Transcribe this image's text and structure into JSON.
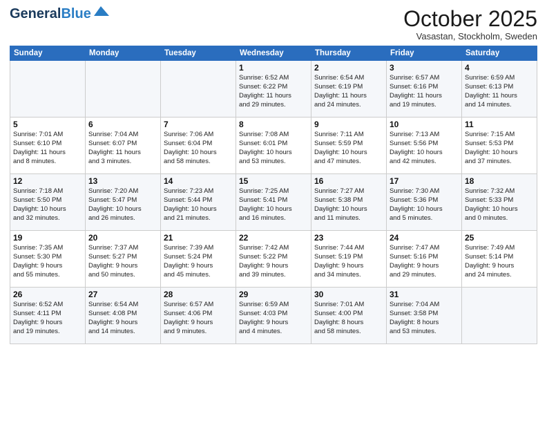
{
  "logo": {
    "line1": "General",
    "line2": "Blue"
  },
  "title": "October 2025",
  "location": "Vasastan, Stockholm, Sweden",
  "header_days": [
    "Sunday",
    "Monday",
    "Tuesday",
    "Wednesday",
    "Thursday",
    "Friday",
    "Saturday"
  ],
  "weeks": [
    [
      {
        "day": "",
        "info": ""
      },
      {
        "day": "",
        "info": ""
      },
      {
        "day": "",
        "info": ""
      },
      {
        "day": "1",
        "info": "Sunrise: 6:52 AM\nSunset: 6:22 PM\nDaylight: 11 hours\nand 29 minutes."
      },
      {
        "day": "2",
        "info": "Sunrise: 6:54 AM\nSunset: 6:19 PM\nDaylight: 11 hours\nand 24 minutes."
      },
      {
        "day": "3",
        "info": "Sunrise: 6:57 AM\nSunset: 6:16 PM\nDaylight: 11 hours\nand 19 minutes."
      },
      {
        "day": "4",
        "info": "Sunrise: 6:59 AM\nSunset: 6:13 PM\nDaylight: 11 hours\nand 14 minutes."
      }
    ],
    [
      {
        "day": "5",
        "info": "Sunrise: 7:01 AM\nSunset: 6:10 PM\nDaylight: 11 hours\nand 8 minutes."
      },
      {
        "day": "6",
        "info": "Sunrise: 7:04 AM\nSunset: 6:07 PM\nDaylight: 11 hours\nand 3 minutes."
      },
      {
        "day": "7",
        "info": "Sunrise: 7:06 AM\nSunset: 6:04 PM\nDaylight: 10 hours\nand 58 minutes."
      },
      {
        "day": "8",
        "info": "Sunrise: 7:08 AM\nSunset: 6:01 PM\nDaylight: 10 hours\nand 53 minutes."
      },
      {
        "day": "9",
        "info": "Sunrise: 7:11 AM\nSunset: 5:59 PM\nDaylight: 10 hours\nand 47 minutes."
      },
      {
        "day": "10",
        "info": "Sunrise: 7:13 AM\nSunset: 5:56 PM\nDaylight: 10 hours\nand 42 minutes."
      },
      {
        "day": "11",
        "info": "Sunrise: 7:15 AM\nSunset: 5:53 PM\nDaylight: 10 hours\nand 37 minutes."
      }
    ],
    [
      {
        "day": "12",
        "info": "Sunrise: 7:18 AM\nSunset: 5:50 PM\nDaylight: 10 hours\nand 32 minutes."
      },
      {
        "day": "13",
        "info": "Sunrise: 7:20 AM\nSunset: 5:47 PM\nDaylight: 10 hours\nand 26 minutes."
      },
      {
        "day": "14",
        "info": "Sunrise: 7:23 AM\nSunset: 5:44 PM\nDaylight: 10 hours\nand 21 minutes."
      },
      {
        "day": "15",
        "info": "Sunrise: 7:25 AM\nSunset: 5:41 PM\nDaylight: 10 hours\nand 16 minutes."
      },
      {
        "day": "16",
        "info": "Sunrise: 7:27 AM\nSunset: 5:38 PM\nDaylight: 10 hours\nand 11 minutes."
      },
      {
        "day": "17",
        "info": "Sunrise: 7:30 AM\nSunset: 5:36 PM\nDaylight: 10 hours\nand 5 minutes."
      },
      {
        "day": "18",
        "info": "Sunrise: 7:32 AM\nSunset: 5:33 PM\nDaylight: 10 hours\nand 0 minutes."
      }
    ],
    [
      {
        "day": "19",
        "info": "Sunrise: 7:35 AM\nSunset: 5:30 PM\nDaylight: 9 hours\nand 55 minutes."
      },
      {
        "day": "20",
        "info": "Sunrise: 7:37 AM\nSunset: 5:27 PM\nDaylight: 9 hours\nand 50 minutes."
      },
      {
        "day": "21",
        "info": "Sunrise: 7:39 AM\nSunset: 5:24 PM\nDaylight: 9 hours\nand 45 minutes."
      },
      {
        "day": "22",
        "info": "Sunrise: 7:42 AM\nSunset: 5:22 PM\nDaylight: 9 hours\nand 39 minutes."
      },
      {
        "day": "23",
        "info": "Sunrise: 7:44 AM\nSunset: 5:19 PM\nDaylight: 9 hours\nand 34 minutes."
      },
      {
        "day": "24",
        "info": "Sunrise: 7:47 AM\nSunset: 5:16 PM\nDaylight: 9 hours\nand 29 minutes."
      },
      {
        "day": "25",
        "info": "Sunrise: 7:49 AM\nSunset: 5:14 PM\nDaylight: 9 hours\nand 24 minutes."
      }
    ],
    [
      {
        "day": "26",
        "info": "Sunrise: 6:52 AM\nSunset: 4:11 PM\nDaylight: 9 hours\nand 19 minutes."
      },
      {
        "day": "27",
        "info": "Sunrise: 6:54 AM\nSunset: 4:08 PM\nDaylight: 9 hours\nand 14 minutes."
      },
      {
        "day": "28",
        "info": "Sunrise: 6:57 AM\nSunset: 4:06 PM\nDaylight: 9 hours\nand 9 minutes."
      },
      {
        "day": "29",
        "info": "Sunrise: 6:59 AM\nSunset: 4:03 PM\nDaylight: 9 hours\nand 4 minutes."
      },
      {
        "day": "30",
        "info": "Sunrise: 7:01 AM\nSunset: 4:00 PM\nDaylight: 8 hours\nand 58 minutes."
      },
      {
        "day": "31",
        "info": "Sunrise: 7:04 AM\nSunset: 3:58 PM\nDaylight: 8 hours\nand 53 minutes."
      },
      {
        "day": "",
        "info": ""
      }
    ]
  ]
}
